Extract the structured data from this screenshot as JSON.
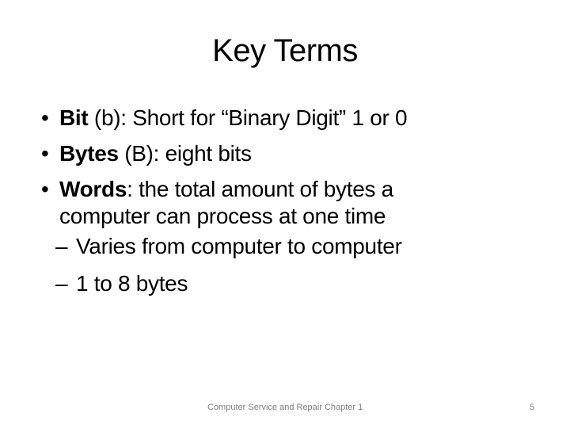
{
  "slide": {
    "title": "Key Terms",
    "bullets": [
      {
        "term": "Bit",
        "rest": " (b): Short for “Binary Digit” 1 or 0"
      },
      {
        "term": "Bytes",
        "rest": " (B): eight bits"
      },
      {
        "term": "Words",
        "rest": ": the total amount of bytes a computer can process at one time"
      }
    ],
    "sub_bullets": [
      "Varies from computer to computer",
      "1 to 8 bytes"
    ],
    "bullet_glyph": "•",
    "dash_glyph": "–"
  },
  "footer": {
    "text": "Computer Service and Repair Chapter 1",
    "page_number": "5"
  }
}
